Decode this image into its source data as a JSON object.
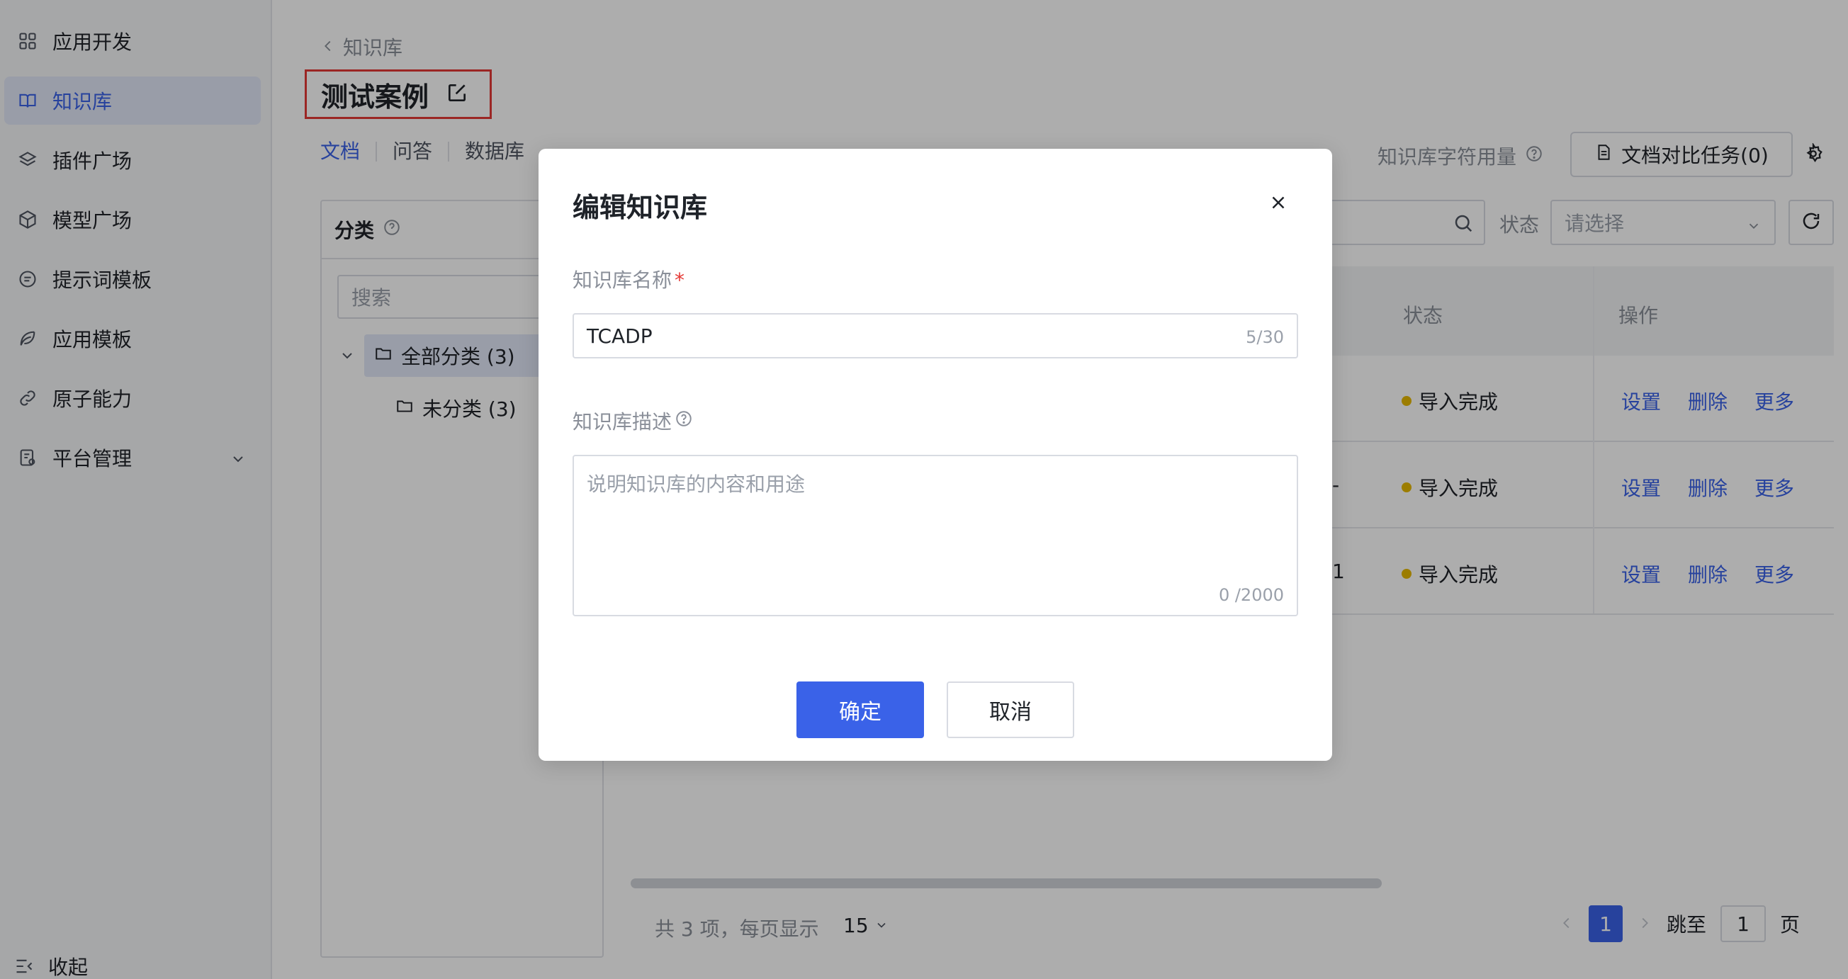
{
  "sidebar": {
    "items": [
      {
        "label": "应用开发",
        "icon": "grid-icon"
      },
      {
        "label": "知识库",
        "icon": "book-icon"
      },
      {
        "label": "插件广场",
        "icon": "layers-icon"
      },
      {
        "label": "模型广场",
        "icon": "cube-icon"
      },
      {
        "label": "提示词模板",
        "icon": "chat-icon"
      },
      {
        "label": "应用模板",
        "icon": "leaf-icon"
      },
      {
        "label": "原子能力",
        "icon": "link-icon"
      },
      {
        "label": "平台管理",
        "icon": "admin-icon"
      }
    ],
    "active_index": 1,
    "collapse_label": "收起"
  },
  "breadcrumb": {
    "label": "知识库"
  },
  "page": {
    "title": "测试案例"
  },
  "tabs": [
    {
      "label": "文档",
      "active": true
    },
    {
      "label": "问答",
      "active": false
    },
    {
      "label": "数据库",
      "active": false
    }
  ],
  "toolbar": {
    "usage_label": "知识库字符用量",
    "compare_button": "文档对比任务(0)",
    "status_label": "状态",
    "status_placeholder": "请选择"
  },
  "category": {
    "title": "分类",
    "search_placeholder": "搜索",
    "all_label": "全部分类 (3)",
    "uncategorized_label": "未分类 (3)"
  },
  "table": {
    "columns": {
      "status": "状态",
      "ops": "操作"
    },
    "rows": [
      {
        "stub": "",
        "status": "导入完成",
        "ops": [
          "设置",
          "删除",
          "更多"
        ]
      },
      {
        "stub": "-",
        "status": "导入完成",
        "ops": [
          "设置",
          "删除",
          "更多"
        ]
      },
      {
        "stub": "1",
        "status": "导入完成",
        "ops": [
          "设置",
          "删除",
          "更多"
        ]
      }
    ]
  },
  "footer": {
    "total": "共 3 项，每页显示",
    "page_size": "15",
    "current_page": "1",
    "goto_label": "跳至",
    "goto_value": "1",
    "page_suffix": "页"
  },
  "modal": {
    "title": "编辑知识库",
    "name_label": "知识库名称",
    "name_value": "TCADP",
    "name_count": "5/30",
    "desc_label": "知识库描述",
    "desc_placeholder": "说明知识库的内容和用途",
    "desc_count": "0 /2000",
    "ok_label": "确定",
    "cancel_label": "取消"
  },
  "colors": {
    "accent": "#3a62e8",
    "status_dot": "#e6b800",
    "highlight_border": "#e53935"
  }
}
